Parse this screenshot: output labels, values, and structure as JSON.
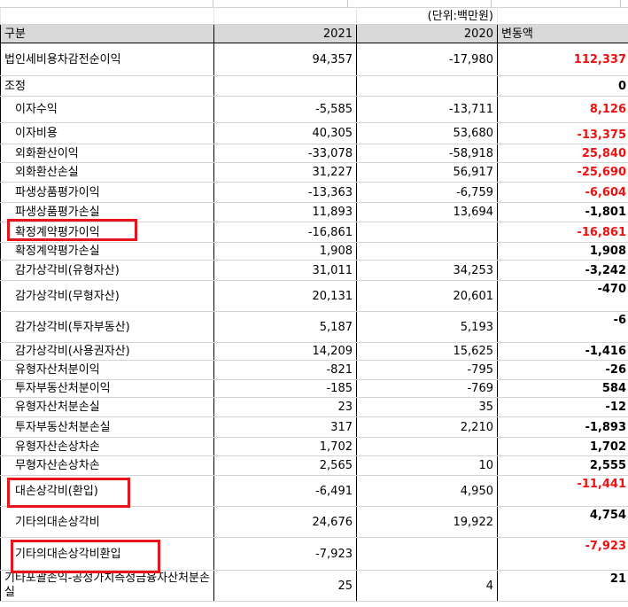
{
  "unit_note": "(단위:백만원)",
  "headers": {
    "category": "구분",
    "y2021": "2021",
    "y2020": "2020",
    "change": "변동액"
  },
  "rows": [
    {
      "label": "법인세비용차감전순이익",
      "v2021": "94,357",
      "v2020": "-17,980",
      "change": "112,337",
      "red": true
    },
    {
      "label": "조정",
      "v2021": "",
      "v2020": "",
      "change": "0",
      "red": false
    },
    {
      "label": "이자수익",
      "v2021": "-5,585",
      "v2020": "-13,711",
      "change": "8,126",
      "red": true
    },
    {
      "label": "이자비용",
      "v2021": "40,305",
      "v2020": "53,680",
      "change": "-13,375",
      "red": true
    },
    {
      "label": "외화환산이익",
      "v2021": "-33,078",
      "v2020": "-58,918",
      "change": "25,840",
      "red": true
    },
    {
      "label": "외화환산손실",
      "v2021": "31,227",
      "v2020": "56,917",
      "change": "-25,690",
      "red": true
    },
    {
      "label": "파생상품평가이익",
      "v2021": "-13,363",
      "v2020": "-6,759",
      "change": "-6,604",
      "red": true
    },
    {
      "label": "파생상품평가손실",
      "v2021": "11,893",
      "v2020": "13,694",
      "change": "-1,801",
      "red": false
    },
    {
      "label": "확정계약평가이익",
      "v2021": "-16,861",
      "v2020": "",
      "change": "-16,861",
      "red": true
    },
    {
      "label": "확정계약평가손실",
      "v2021": "1,908",
      "v2020": "",
      "change": "1,908",
      "red": false
    },
    {
      "label": "감가상각비(유형자산)",
      "v2021": "31,011",
      "v2020": "34,253",
      "change": "-3,242",
      "red": false
    },
    {
      "label": "감가상각비(무형자산)",
      "v2021": "20,131",
      "v2020": "20,601",
      "change": "-470",
      "red": false
    },
    {
      "label": "감가상각비(투자부동산)",
      "v2021": "5,187",
      "v2020": "5,193",
      "change": "-6",
      "red": false
    },
    {
      "label": "감가상각비(사용권자산)",
      "v2021": "14,209",
      "v2020": "15,625",
      "change": "-1,416",
      "red": false
    },
    {
      "label": "유형자산처분이익",
      "v2021": "-821",
      "v2020": "-795",
      "change": "-26",
      "red": false
    },
    {
      "label": "투자부동산처분이익",
      "v2021": "-185",
      "v2020": "-769",
      "change": "584",
      "red": false
    },
    {
      "label": "유형자산처분손실",
      "v2021": "23",
      "v2020": "35",
      "change": "-12",
      "red": false
    },
    {
      "label": "투자부동산처분손실",
      "v2021": "317",
      "v2020": "2,210",
      "change": "-1,893",
      "red": false
    },
    {
      "label": "유형자산손상차손",
      "v2021": "1,702",
      "v2020": "",
      "change": "1,702",
      "red": false
    },
    {
      "label": "무형자산손상차손",
      "v2021": "2,565",
      "v2020": "10",
      "change": "2,555",
      "red": false
    },
    {
      "label": "대손상각비(환입)",
      "v2021": "-6,491",
      "v2020": "4,950",
      "change": "-11,441",
      "red": true
    },
    {
      "label": "기타의대손상각비",
      "v2021": "24,676",
      "v2020": "19,922",
      "change": "4,754",
      "red": false
    },
    {
      "label": "기타의대손상각비환입",
      "v2021": "-7,923",
      "v2020": "",
      "change": "-7,923",
      "red": true
    },
    {
      "label": "기타포괄손익-공정가치측정금융자산처분손실",
      "v2021": "25",
      "v2020": "4",
      "change": "21",
      "red": false
    }
  ],
  "highlight_color": "#e8141b"
}
